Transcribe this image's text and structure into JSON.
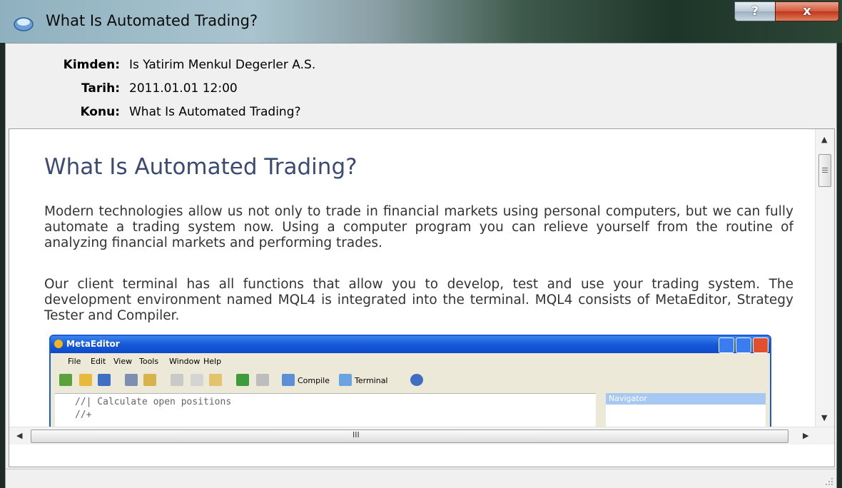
{
  "window": {
    "title": "What Is Automated Trading?",
    "help_label": "?",
    "close_label": "x"
  },
  "header": {
    "from_label": "Kimden:",
    "from_value": "Is Yatirim Menkul Degerler A.S.",
    "date_label": "Tarih:",
    "date_value": "2011.01.01 12:00",
    "subject_label": "Konu:",
    "subject_value": "What Is Automated Trading?"
  },
  "article": {
    "heading": "What Is Automated Trading?",
    "paragraph1": "Modern technologies allow us not only to trade in financial markets using personal computers, but we can fully automate a trading system now. Using a computer program you can relieve yourself from the routine of analyzing financial markets and performing trades.",
    "paragraph2": "Our client terminal has all functions that allow you to develop, test and use your trading system. The development environment named MQL4 is integrated into the terminal. MQL4 consists of MetaEditor, Strategy Tester and Compiler."
  },
  "embedded_screenshot": {
    "title": "MetaEditor",
    "menu": [
      "File",
      "Edit",
      "View",
      "Tools",
      "Window",
      "Help"
    ],
    "toolbar_compile": "Compile",
    "toolbar_terminal": "Terminal",
    "code_line": "//| Calculate open positions",
    "code_line2": "//+",
    "navigator_title": "Navigator"
  },
  "scrollbar": {
    "grip_label": "III"
  },
  "colors": {
    "heading": "#3b4a73",
    "body_text": "#333333",
    "xp_title": "#1658d9",
    "close_button": "#c0361b"
  }
}
